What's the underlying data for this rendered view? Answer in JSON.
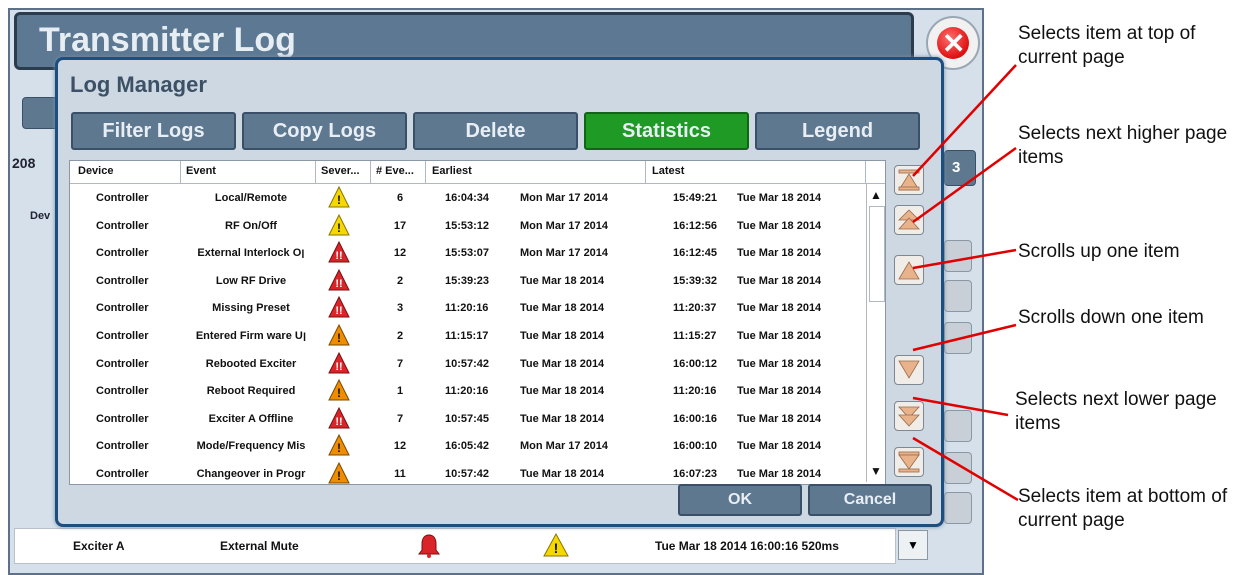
{
  "background_window": {
    "title": "Transmitter Log",
    "partial_count": "208",
    "partial_col": "Dev",
    "partial_right_btn": "3",
    "bottom_row": {
      "device": "Exciter A",
      "event": "External Mute",
      "time": "Tue Mar 18 2014 16:00:16 520ms"
    }
  },
  "dialog": {
    "title": "Log Manager",
    "tabs": [
      {
        "label": "Filter Logs",
        "active": false
      },
      {
        "label": "Copy Logs",
        "active": false
      },
      {
        "label": "Delete",
        "active": false
      },
      {
        "label": "Statistics",
        "active": true
      },
      {
        "label": "Legend",
        "active": false
      }
    ],
    "columns": [
      "Device",
      "Event",
      "Sever...",
      "# Eve...",
      "Earliest",
      "Latest"
    ],
    "rows": [
      {
        "device": "Controller",
        "event": "Local/Remote",
        "severity": "yellow",
        "count": "6",
        "earliest_time": "16:04:34",
        "earliest_date": "Mon Mar 17 2014",
        "latest_time": "15:49:21",
        "latest_date": "Tue Mar 18 2014"
      },
      {
        "device": "Controller",
        "event": "RF On/Off",
        "severity": "yellow",
        "count": "17",
        "earliest_time": "15:53:12",
        "earliest_date": "Mon Mar 17 2014",
        "latest_time": "16:12:56",
        "latest_date": "Tue Mar 18 2014"
      },
      {
        "device": "Controller",
        "event": "External Interlock Oן",
        "severity": "red",
        "count": "12",
        "earliest_time": "15:53:07",
        "earliest_date": "Mon Mar 17 2014",
        "latest_time": "16:12:45",
        "latest_date": "Tue Mar 18 2014"
      },
      {
        "device": "Controller",
        "event": "Low RF Drive",
        "severity": "red",
        "count": "2",
        "earliest_time": "15:39:23",
        "earliest_date": "Tue Mar 18 2014",
        "latest_time": "15:39:32",
        "latest_date": "Tue Mar 18 2014"
      },
      {
        "device": "Controller",
        "event": "Missing Preset",
        "severity": "red",
        "count": "3",
        "earliest_time": "11:20:16",
        "earliest_date": "Tue Mar 18 2014",
        "latest_time": "11:20:37",
        "latest_date": "Tue Mar 18 2014"
      },
      {
        "device": "Controller",
        "event": "Entered Firm ware Uן",
        "severity": "orange",
        "count": "2",
        "earliest_time": "11:15:17",
        "earliest_date": "Tue Mar 18 2014",
        "latest_time": "11:15:27",
        "latest_date": "Tue Mar 18 2014"
      },
      {
        "device": "Controller",
        "event": "Rebooted Exciter",
        "severity": "red",
        "count": "7",
        "earliest_time": "10:57:42",
        "earliest_date": "Tue Mar 18 2014",
        "latest_time": "16:00:12",
        "latest_date": "Tue Mar 18 2014"
      },
      {
        "device": "Controller",
        "event": "Reboot Required",
        "severity": "orange",
        "count": "1",
        "earliest_time": "11:20:16",
        "earliest_date": "Tue Mar 18 2014",
        "latest_time": "11:20:16",
        "latest_date": "Tue Mar 18 2014"
      },
      {
        "device": "Controller",
        "event": "Exciter A Offline",
        "severity": "red",
        "count": "7",
        "earliest_time": "10:57:45",
        "earliest_date": "Tue Mar 18 2014",
        "latest_time": "16:00:16",
        "latest_date": "Tue Mar 18 2014"
      },
      {
        "device": "Controller",
        "event": "Mode/Frequency Mis",
        "severity": "orange",
        "count": "12",
        "earliest_time": "16:05:42",
        "earliest_date": "Mon Mar 17 2014",
        "latest_time": "16:00:10",
        "latest_date": "Tue Mar 18 2014"
      },
      {
        "device": "Controller",
        "event": "Changeover in Progr",
        "severity": "orange",
        "count": "11",
        "earliest_time": "10:57:42",
        "earliest_date": "Tue Mar 18 2014",
        "latest_time": "16:07:23",
        "latest_date": "Tue Mar 18 2014"
      }
    ],
    "ok_label": "OK",
    "cancel_label": "Cancel"
  },
  "callouts": [
    "Selects item at top of current page",
    "Selects next higher page items",
    "Scrolls up one item",
    "Scrolls down one item",
    "Selects next lower page items",
    "Selects item at bottom of current page"
  ],
  "colors": {
    "active_tab": "#1f9a25",
    "tab": "#5e7890",
    "callout_line": "#e00000",
    "yellow": "#f5d800",
    "orange": "#f08c00",
    "red": "#d9252a"
  }
}
